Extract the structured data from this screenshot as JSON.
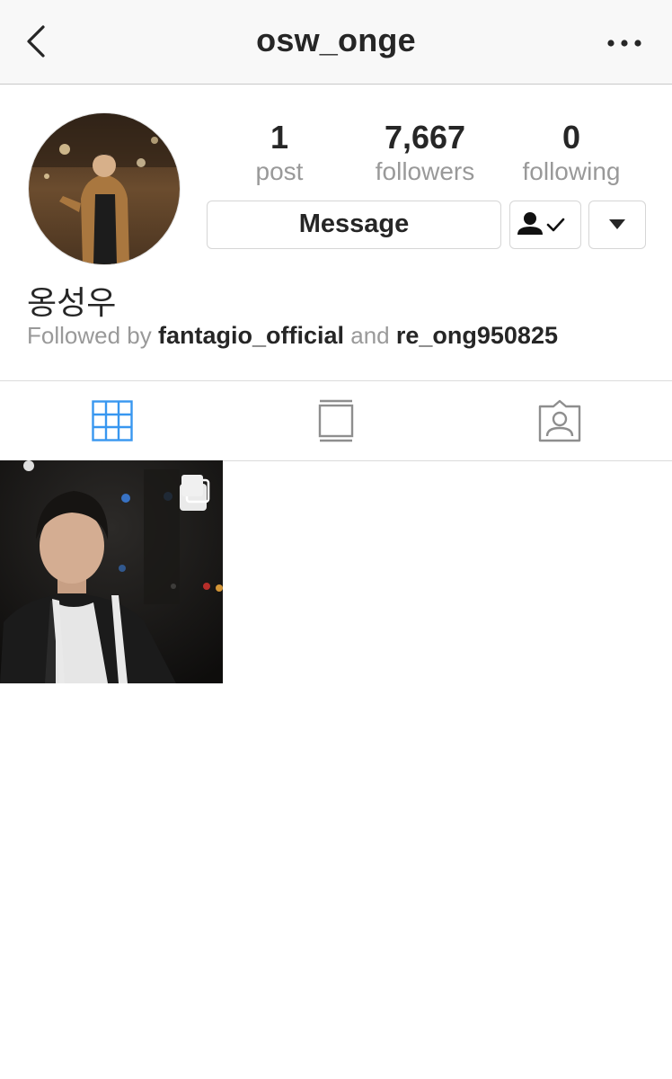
{
  "header": {
    "title": "osw_onge",
    "back_icon": "chevron-left-icon",
    "more_icon": "more-horizontal-icon"
  },
  "profile": {
    "stats": [
      {
        "value": "1",
        "label": "post"
      },
      {
        "value": "7,667",
        "label": "followers"
      },
      {
        "value": "0",
        "label": "following"
      }
    ],
    "message_label": "Message",
    "following_icon": "person-check-icon",
    "dropdown_icon": "caret-down-icon",
    "name": "옹성우",
    "followed_by": {
      "prefix": "Followed by",
      "user1": "fantagio_official",
      "conjunction": "and",
      "user2": "re_ong950825"
    }
  },
  "tabs": [
    {
      "icon": "grid-icon",
      "active": true
    },
    {
      "icon": "feed-icon",
      "active": false
    },
    {
      "icon": "tagged-icon",
      "active": false
    }
  ],
  "colors": {
    "accent": "#3897f0",
    "text": "#262626",
    "muted": "#999999",
    "header_bg": "#f8f8f8"
  }
}
